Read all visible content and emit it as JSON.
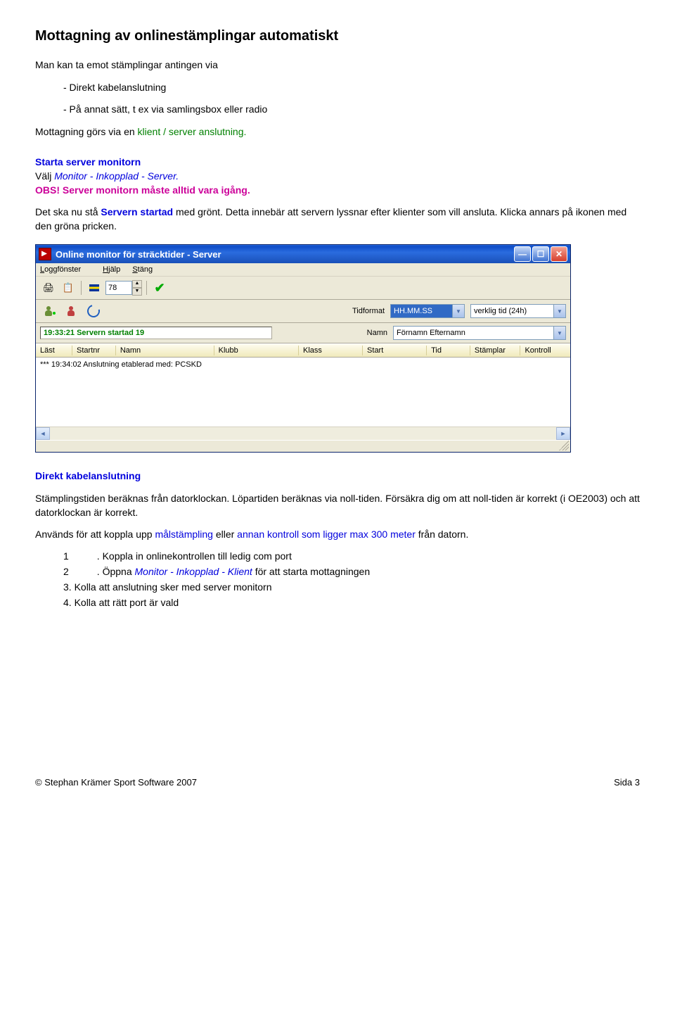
{
  "doc": {
    "title": "Mottagning av onlinestämplingar automatiskt",
    "intro": "Man kan ta emot stämplingar antingen via",
    "bullet1": "- Direkt kabelanslutning",
    "bullet2": "- På annat sätt, t ex via samlingsbox eller radio",
    "para2_a": "Mottagning görs via en ",
    "para2_b": "klient / server anslutning.",
    "h2a": "Starta server monitorn",
    "h2a_sub_a": "Välj ",
    "h2a_sub_b": "Monitor - Inkopplad - Server.",
    "obs": "OBS! Server monitorn måste alltid vara igång.",
    "para3_a": "Det ska nu stå ",
    "para3_b": "Servern startad",
    "para3_c": " med grönt. Detta innebär att servern lyssnar efter klienter som vill ansluta. Klicka annars på ikonen med den gröna pricken.",
    "h2b": "Direkt kabelanslutning",
    "para4": "Stämplingstiden beräknas från datorklockan. Löpartiden beräknas via noll-tiden. Försäkra dig om att noll-tiden är korrekt (i OE2003) och att datorklockan är korrekt.",
    "para5_a": "Används för att koppla upp ",
    "para5_b": "målstämpling",
    "para5_c": " eller ",
    "para5_d": "annan kontroll som ligger max 300 meter",
    "para5_e": " från datorn.",
    "li1_num": "1",
    "li1": ". Koppla in onlinekontrollen till ledig com port",
    "li2_num": "2",
    "li2_a": ". Öppna ",
    "li2_b": "Monitor - Inkopplad - Klient",
    "li2_c": " för att starta mottagningen",
    "li3": "3. Kolla att anslutning sker med server monitorn",
    "li4": "4. Kolla att rätt port är vald"
  },
  "win": {
    "title": "Online monitor för sträcktider - Server",
    "menu1": "Loggfönster",
    "menu2": "Hjälp",
    "menu3": "Stäng",
    "spinner": "78",
    "status": "19:33:21 Servern startad 19",
    "lbl_tid": "Tidformat",
    "combo_tid": "HH.MM.SS",
    "combo_tid2": "verklig tid (24h)",
    "lbl_namn": "Namn",
    "combo_namn": "Förnamn Efternamn",
    "hc1": "Läst",
    "hc2": "Startnr",
    "hc3": "Namn",
    "hc4": "Klubb",
    "hc5": "Klass",
    "hc6": "Start",
    "hc7": "Tid",
    "hc8": "Stämplar",
    "hc9": "Kontroll",
    "logline": "*** 19:34:02 Anslutning etablerad med: PCSKD"
  },
  "footer": {
    "left": "© Stephan Krämer Sport Software 2007",
    "right": "Sida 3"
  }
}
